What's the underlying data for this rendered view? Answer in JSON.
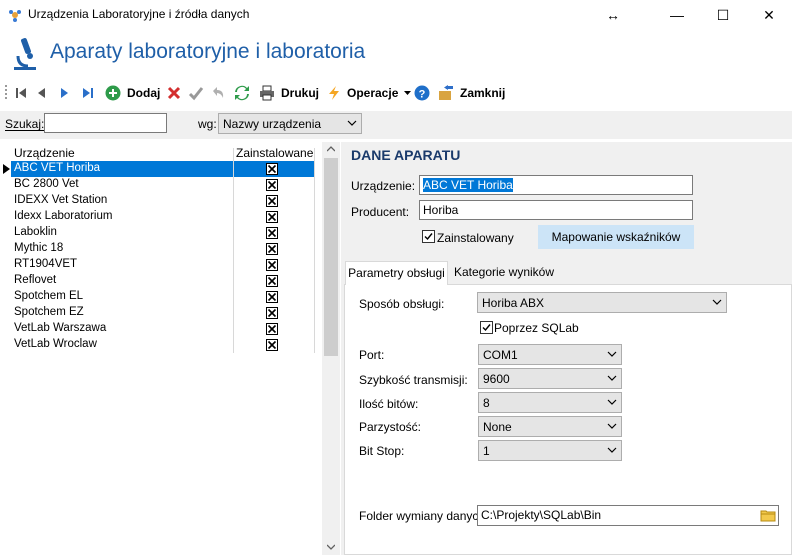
{
  "window": {
    "title": "Urządzenia Laboratoryjne i źródła danych",
    "restore_glyph": "↔",
    "minimize_glyph": "—",
    "maximize_glyph": "☐",
    "close_glyph": "✕"
  },
  "header": {
    "title": "Aparaty laboratoryjne i laboratoria"
  },
  "toolbar": {
    "add_label": "Dodaj",
    "print_label": "Drukuj",
    "operations_label": "Operacje",
    "close_label": "Zamknij"
  },
  "search": {
    "label": "Szukaj:",
    "value": "",
    "by_label": "wg:",
    "by_value": "Nazwy urządzenia"
  },
  "list": {
    "col_name": "Urządzenie",
    "col_installed": "Zainstalowane",
    "items": [
      {
        "name": "ABC VET Horiba",
        "installed": true
      },
      {
        "name": "BC 2800 Vet",
        "installed": true
      },
      {
        "name": "IDEXX Vet Station",
        "installed": true
      },
      {
        "name": "Idexx Laboratorium",
        "installed": true
      },
      {
        "name": "Laboklin",
        "installed": true
      },
      {
        "name": "Mythic 18",
        "installed": true
      },
      {
        "name": "RT1904VET",
        "installed": true
      },
      {
        "name": "Reflovet",
        "installed": true
      },
      {
        "name": "Spotchem EL",
        "installed": true
      },
      {
        "name": "Spotchem EZ",
        "installed": true
      },
      {
        "name": "VetLab Warszawa",
        "installed": true
      },
      {
        "name": "VetLab Wroclaw",
        "installed": true
      }
    ]
  },
  "detail": {
    "title": "DANE APARATU",
    "device_label": "Urządzenie:",
    "device_value": "ABC VET Horiba",
    "producer_label": "Producent:",
    "producer_value": "Horiba",
    "installed_label": "Zainstalowany",
    "mapping_button": "Mapowanie wskaźników"
  },
  "tabs": {
    "tab1": "Parametry obsługi",
    "tab2": "Kategorie wyników"
  },
  "params": {
    "service_label": "Sposób obsługi:",
    "service_value": "Horiba ABX",
    "sqlab_label": "Poprzez SQLab",
    "port_label": "Port:",
    "port_value": "COM1",
    "speed_label": "Szybkość transmisji:",
    "speed_value": "9600",
    "bits_label": "Ilość bitów:",
    "bits_value": "8",
    "parity_label": "Parzystość:",
    "parity_value": "None",
    "stop_label": "Bit Stop:",
    "stop_value": "1",
    "folder_label": "Folder wymiany danych:",
    "folder_value": "C:\\Projekty\\SQLab\\Bin"
  },
  "colors": {
    "accent": "#1f5fa8",
    "selection": "#0078d7",
    "button": "#cce4f7"
  }
}
